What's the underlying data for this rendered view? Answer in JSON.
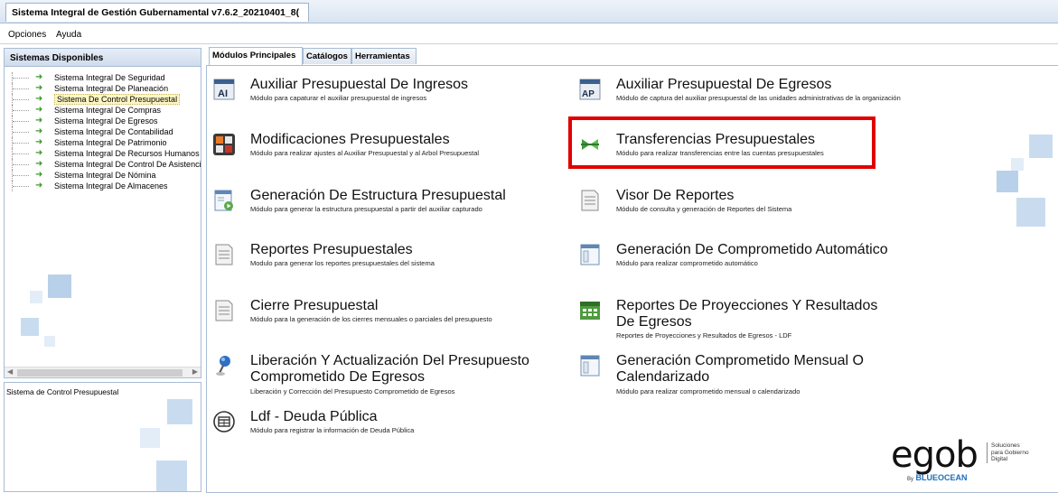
{
  "window": {
    "title": "Sistema Integral de Gestión Gubernamental v7.6.2_20210401_8("
  },
  "menu": {
    "items": [
      "Opciones",
      "Ayuda"
    ]
  },
  "sidebar": {
    "header": "Sistemas Disponibles",
    "items": [
      "Sistema Integral De Seguridad",
      "Sistema Integral De Planeación",
      "Sistema De Control Presupuestal",
      "Sistema Integral De Compras",
      "Sistema Integral De Egresos",
      "Sistema Integral De Contabilidad",
      "Sistema Integral De Patrimonio",
      "Sistema Integral De Recursos Humanos",
      "Sistema Integral De Control De Asistencia",
      "Sistema Integral De Nómina",
      "Sistema Integral De Almacenes"
    ],
    "selected": "Sistema De Control Presupuestal",
    "description": "Sistema de Control Presupuestal"
  },
  "tabs": [
    "Módulos Principales",
    "Catálogos",
    "Herramientas"
  ],
  "modules": [
    {
      "title": "Auxiliar Presupuestal De Ingresos",
      "desc": "Módulo para capaturar el auxiliar presupuestal de ingresos",
      "icon": "ai-icon"
    },
    {
      "title": "Auxiliar Presupuestal De Egresos",
      "desc": "Módulo de captura del auxiliar presupuestal de las unidades administrativas de la organización",
      "icon": "ap-icon"
    },
    {
      "title": "Modificaciones Presupuestales",
      "desc": "Módulo para realizar ajustes al Auxiliar Presupuestal y al Arbol Presupuestal",
      "icon": "grid-icon"
    },
    {
      "title": "Transferencias Presupuestales",
      "desc": "Módulo para realizar transferencias entre las cuentas presupuestales",
      "icon": "transfer-icon"
    },
    {
      "title": "Generación De Estructura Presupuestal",
      "desc": "Módulo para generar la estructura presupuestal a partir del auxiliar capturado",
      "icon": "document-play-icon"
    },
    {
      "title": "Visor De Reportes",
      "desc": "Módulo de consulta y generación de Reportes del Sistema",
      "icon": "report-icon"
    },
    {
      "title": "Reportes Presupuestales",
      "desc": "Modulo para generar los reportes presupuestales del sistema",
      "icon": "report-icon"
    },
    {
      "title": "Generación De Comprometido Automático",
      "desc": "Módulo para realizar comprometido automático",
      "icon": "document-icon"
    },
    {
      "title": "Cierre Presupuestal",
      "desc": "Módulo para la generación de los cierres mensuales o parciales del presupuesto",
      "icon": "report-icon"
    },
    {
      "title": "Reportes De Proyecciones Y Resultados De Egresos",
      "desc": "Reportes de Proyecciones y Resultados de Egresos - LDF",
      "icon": "spreadsheet-icon"
    },
    {
      "title": "Liberación Y Actualización Del Presupuesto Comprometido De Egresos",
      "desc": "Liberación y Corrección del Presupuesto Comprometido de Egresos",
      "icon": "pushpin-icon"
    },
    {
      "title": "Generación Comprometido Mensual O Calendarizado",
      "desc": "Módulo para realizar comprometido mensual o calendarizado",
      "icon": "document-icon"
    },
    {
      "title": "Ldf - Deuda Pública",
      "desc": "Módulo para registrar la información de Deuda Pública",
      "icon": "table-icon"
    }
  ],
  "logo": {
    "brand": "egob",
    "tagline": [
      "Soluciones",
      "para Gobierno",
      "Digital"
    ],
    "by": "By",
    "company": "BLUEOCEAN"
  }
}
